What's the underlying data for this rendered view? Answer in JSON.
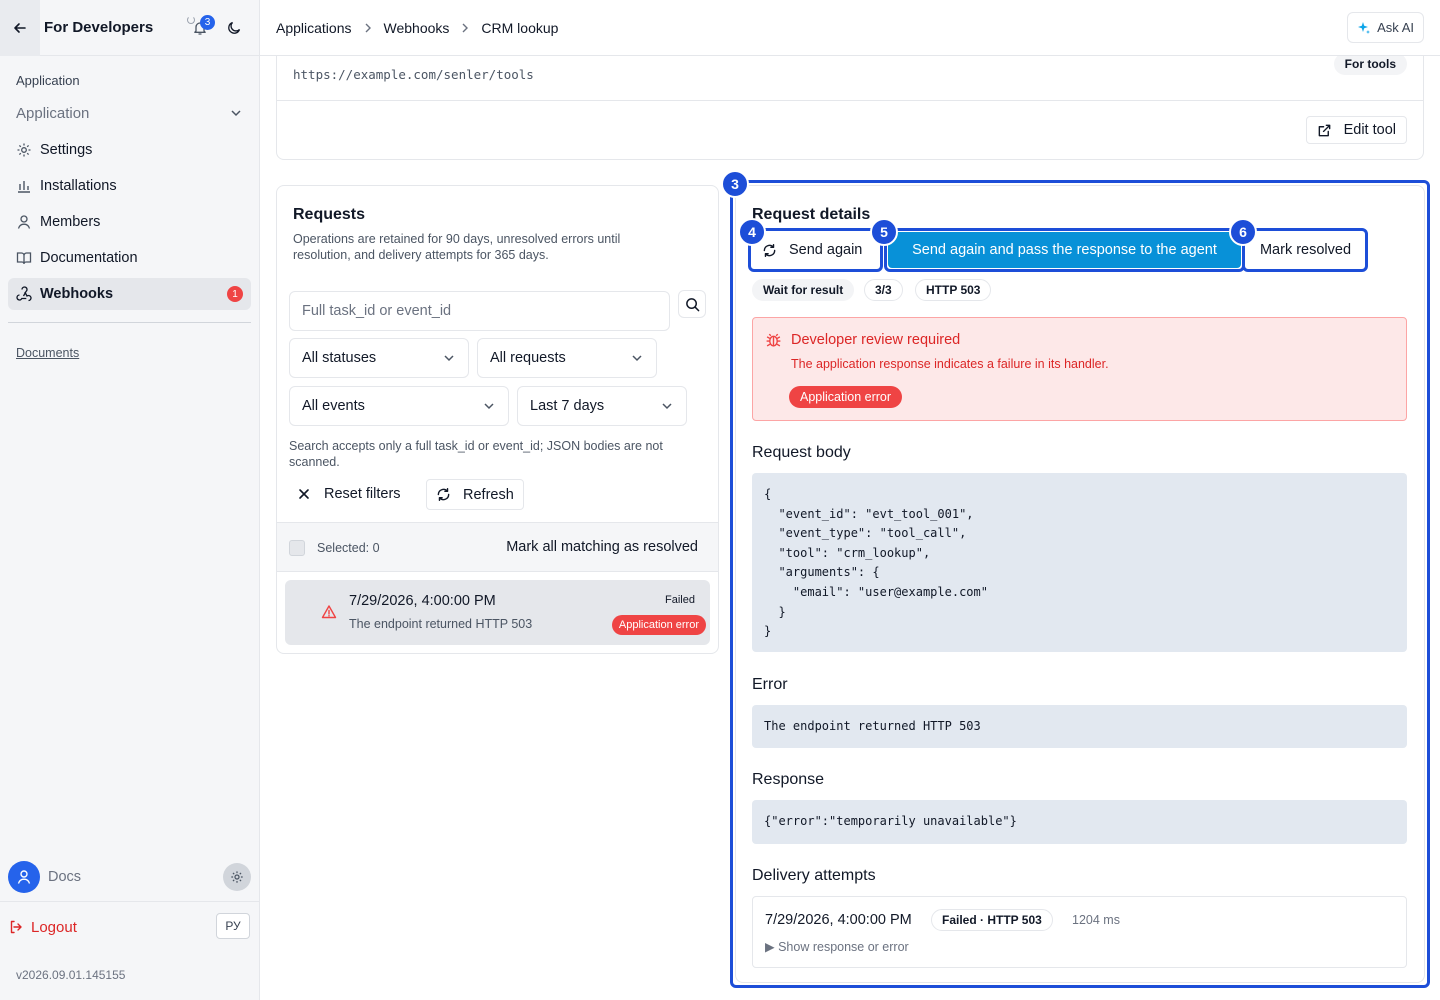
{
  "sidebar": {
    "title": "For Developers",
    "notifications_count": "3",
    "section_label": "Application",
    "app_select_value": "Application",
    "items": [
      {
        "label": "Settings",
        "icon": "gear-icon"
      },
      {
        "label": "Installations",
        "icon": "bar-chart-icon"
      },
      {
        "label": "Members",
        "icon": "user-icon"
      },
      {
        "label": "Documentation",
        "icon": "book-icon"
      },
      {
        "label": "Webhooks",
        "icon": "webhook-icon",
        "count": "1",
        "active": true
      }
    ],
    "documents_link": "Documents",
    "user_name": "Docs",
    "logout_label": "Logout",
    "lang_label": "РУ",
    "version": "v2026.09.01.145155"
  },
  "breadcrumbs": [
    "Applications",
    "Webhooks",
    "CRM lookup"
  ],
  "ask_ai_label": "Ask AI",
  "tool": {
    "url": "https://example.com/senler/tools",
    "badge": "For tools",
    "edit_label": "Edit tool"
  },
  "requests": {
    "title": "Requests",
    "description": "Operations are retained for 90 days, unresolved errors until resolution, and delivery attempts for 365 days.",
    "search_placeholder": "Full task_id or event_id",
    "filters": {
      "status": "All statuses",
      "request": "All requests",
      "event": "All events",
      "period": "Last 7 days"
    },
    "filter_hint": "Search accepts only a full task_id or event_id; JSON bodies are not scanned.",
    "reset_label": "Reset filters",
    "refresh_label": "Refresh",
    "selected_label": "Selected: 0",
    "mark_all_label": "Mark all matching as resolved",
    "rows": [
      {
        "date": "7/29/2026, 4:00:00 PM",
        "message": "The endpoint returned HTTP 503",
        "status": "Failed",
        "error_type": "Application error"
      }
    ]
  },
  "details": {
    "title": "Request details",
    "markers": {
      "panel": "3",
      "send_again": "4",
      "send_pass": "5",
      "resolve": "6"
    },
    "send_again_label": "Send again",
    "send_pass_label": "Send again and pass the response to the agent",
    "mark_resolved_label": "Mark resolved",
    "tags": [
      "Wait for result",
      "3/3",
      "HTTP 503"
    ],
    "alert": {
      "title": "Developer review required",
      "text": "The application response indicates a failure in its handler.",
      "pill": "Application error"
    },
    "body_title": "Request body",
    "body_code": "{\n  \"event_id\": \"evt_tool_001\",\n  \"event_type\": \"tool_call\",\n  \"tool\": \"crm_lookup\",\n  \"arguments\": {\n    \"email\": \"user@example.com\"\n  }\n}",
    "error_title": "Error",
    "error_code": "The endpoint returned HTTP 503",
    "response_title": "Response",
    "response_code": "{\"error\":\"temporarily unavailable\"}",
    "attempts_title": "Delivery attempts",
    "attempt": {
      "date": "7/29/2026, 4:00:00 PM",
      "status": "Failed · HTTP 503",
      "duration": "1204 ms",
      "toggle": "▶ Show response or error"
    }
  },
  "colors": {
    "accent": "#1d4ed8",
    "primary_button": "#0891d8",
    "danger": "#ef4444"
  }
}
